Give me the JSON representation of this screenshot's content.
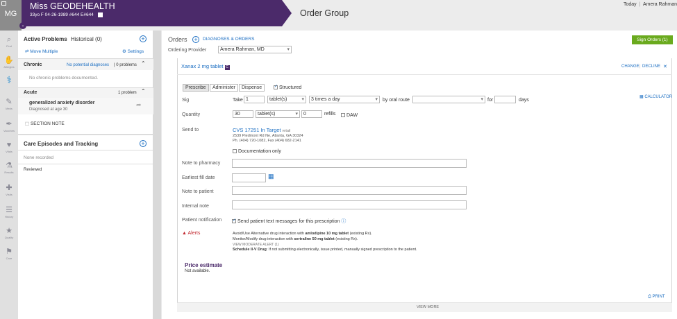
{
  "header": {
    "avatar_initials": "MG",
    "patient_name": "Miss GEODEHEALTH",
    "patient_info": "33yo F   04-26-1989   #644   E#644",
    "title": "Order Group",
    "today_label": "Today",
    "separator": "|",
    "user_name": "Amera Rahman"
  },
  "rail": [
    {
      "icon": "search-icon",
      "label": "Find"
    },
    {
      "icon": "allergies-icon",
      "label": "Allergies"
    },
    {
      "icon": "diagnosis-icon",
      "label": ""
    },
    {
      "icon": "meds-icon",
      "label": "Meds"
    },
    {
      "icon": "vaccines-icon",
      "label": "Vaccines"
    },
    {
      "icon": "vitals-icon",
      "label": "Vitals"
    },
    {
      "icon": "results-icon",
      "label": "Results"
    },
    {
      "icon": "visits-icon",
      "label": "Visits"
    },
    {
      "icon": "history-icon",
      "label": "History"
    },
    {
      "icon": "quality-icon",
      "label": "Quality"
    },
    {
      "icon": "care-icon",
      "label": "Care"
    }
  ],
  "left_panel": {
    "active_problems_title": "Active Problems",
    "historical": "Historical (0)",
    "move_multiple": "Move Multiple",
    "settings": "Settings",
    "chronic_title": "Chronic",
    "chronic_link": "No potential diagnoses",
    "chronic_count": "| 0 problems",
    "chronic_empty": "No chronic problems documented.",
    "acute_title": "Acute",
    "acute_count": "1 problem",
    "problem_name": "generalized anxiety disorder",
    "problem_detail": "Diagnosed at age 30",
    "section_note": "SECTION NOTE",
    "care_title": "Care Episodes and Tracking",
    "care_empty": "None recorded",
    "reviewed": "Reviewed"
  },
  "main": {
    "orders_label": "Orders",
    "diagnoses_link": "DIAGNOSES & ORDERS",
    "sign_orders": "Sign Orders (1)",
    "ordering_provider_label": "Ordering Provider",
    "ordering_provider_value": "Amera Rahman, MD",
    "drug_name": "Xanax 2 mg tablet",
    "change": "CHANGE",
    "decline": "DECLINE",
    "close": "✕",
    "tabs": [
      "Prescribe",
      "Administer",
      "Dispense"
    ],
    "structured_label": "Structured",
    "sig_label": "Sig",
    "take_label": "Take",
    "take_qty": "1",
    "take_unit": "tablet(s)",
    "frequency": "3 times a day",
    "route": "by oral route",
    "for_label": "for",
    "days_label": "days",
    "calculator": "CALCULATOR",
    "quantity_label": "Quantity",
    "quantity_value": "30",
    "quantity_unit": "tablet(s)",
    "refills_value": "0",
    "refills_label": "refills",
    "daw_label": "DAW",
    "send_to_label": "Send to",
    "pharmacy_name": "CVS 17251 In Target",
    "pharmacy_type": "retail",
    "pharmacy_address": "2539 Piedmont Rd Ne, Atlanta, GA 30324",
    "pharmacy_phone": "Ph. (404) 720-1082, Fax (404) 682-2141",
    "documentation_only": "Documentation only",
    "note_to_pharmacy_label": "Note to pharmacy",
    "earliest_fill_label": "Earliest fill date",
    "note_to_patient_label": "Note to patient",
    "internal_note_label": "Internal note",
    "patient_notification_label": "Patient notification",
    "patient_notification_text": "Send patient text messages for this prescription",
    "alerts_label": "Alerts",
    "alert1_prefix": "Avoid/Use Alternative drug interaction with ",
    "alert1_drug": "amlodipine 10 mg tablet",
    "alert1_suffix": " (existing Rx).",
    "alert2_prefix": "Monitor/Modify drug interaction with ",
    "alert2_drug": "sertraline 50 mg tablet",
    "alert2_suffix": " (existing Rx).",
    "view_moderate": "VIEW MODERATE ALERT (1)",
    "schedule_bold": "Schedule II-V Drug",
    "schedule_text": ": If not submitting electronically, issue printed, manually signed prescription to the patient.",
    "price_estimate_title": "Price estimate",
    "price_estimate_value": "Not available.",
    "print": "PRINT",
    "view_more": "VIEW MORE"
  },
  "colors": {
    "brand_purple": "#4b2a6a",
    "link_blue": "#1b6ec2",
    "sign_green": "#6aaa1e",
    "alert_red": "#c0262d"
  }
}
